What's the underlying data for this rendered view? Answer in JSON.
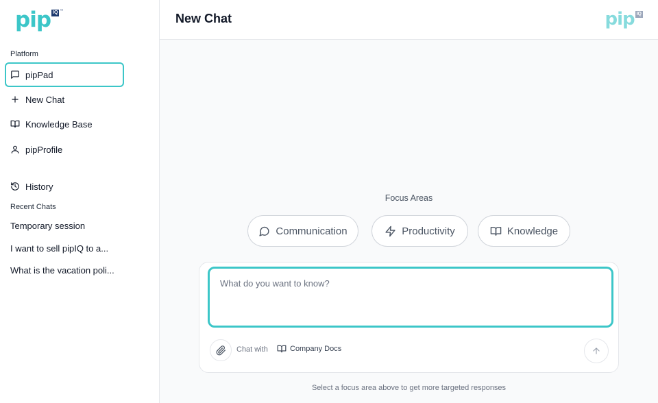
{
  "brand": {
    "logo_text": "pip",
    "logo_badge": "IQ",
    "logo_tm": "™",
    "accent_color": "#3cc6c8",
    "badge_color": "#1e3a6e"
  },
  "sidebar": {
    "platform_label": "Platform",
    "items": [
      {
        "label": "pipPad",
        "icon": "message-square-icon",
        "active": true
      },
      {
        "label": "New Chat",
        "icon": "plus-icon"
      },
      {
        "label": "Knowledge Base",
        "icon": "book-open-icon"
      },
      {
        "label": "pipProfile",
        "icon": "user-icon"
      }
    ],
    "history_label": "History",
    "recent_label": "Recent Chats",
    "recent_chats": [
      "Temporary session",
      "I want to sell pipIQ to a...",
      "What is the vacation poli..."
    ]
  },
  "header": {
    "title": "New Chat"
  },
  "focus": {
    "label": "Focus Areas",
    "areas": [
      {
        "label": "Communication",
        "icon": "message-circle-icon"
      },
      {
        "label": "Productivity",
        "icon": "zap-icon"
      },
      {
        "label": "Knowledge",
        "icon": "book-open-icon"
      }
    ]
  },
  "composer": {
    "placeholder": "What do you want to know?",
    "chat_with_label": "Chat with",
    "source_label": "Company Docs"
  },
  "hint": "Select a focus area above to get more targeted responses"
}
